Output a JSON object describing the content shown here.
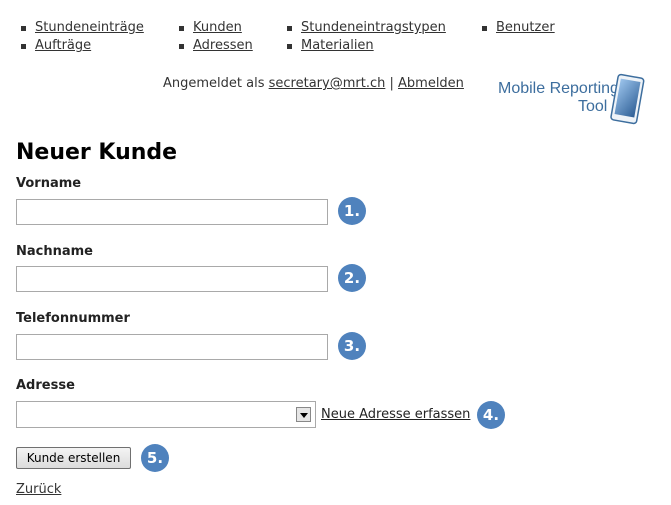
{
  "nav": {
    "items": [
      {
        "label": "Stundeneinträge"
      },
      {
        "label": "Aufträge"
      },
      {
        "label": "Kunden"
      },
      {
        "label": "Adressen"
      },
      {
        "label": "Stundeneintragstypen"
      },
      {
        "label": "Materialien"
      },
      {
        "label": "Benutzer"
      }
    ]
  },
  "login": {
    "prefix": "Angemeldet als",
    "user": "secretary@mrt.ch",
    "separator": "|",
    "logout": "Abmelden"
  },
  "logo": {
    "line1": "Mobile Reporting",
    "line2": "Tool",
    "icon": "tablet-icon"
  },
  "page": {
    "title": "Neuer Kunde"
  },
  "form": {
    "firstname_label": "Vorname",
    "firstname_value": "",
    "lastname_label": "Nachname",
    "lastname_value": "",
    "phone_label": "Telefonnummer",
    "phone_value": "",
    "address_label": "Adresse",
    "address_selected": "",
    "new_address_link": "Neue Adresse erfassen",
    "submit_label": "Kunde erstellen"
  },
  "badges": [
    "1.",
    "2.",
    "3.",
    "4.",
    "5."
  ],
  "footer": {
    "back_link": "Zurück"
  },
  "colors": {
    "badge": "#4f82bd",
    "logo": "#3d6e9e"
  }
}
